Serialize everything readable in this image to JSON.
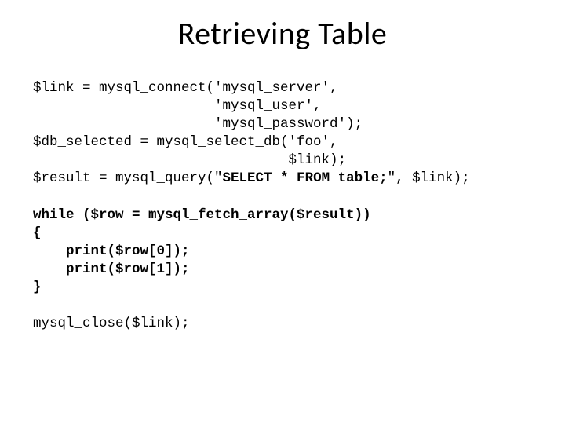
{
  "title": "Retrieving Table",
  "code": {
    "l1": "$link = mysql_connect('mysql_server',",
    "l2": "                      'mysql_user',",
    "l3": "                      'mysql_password');",
    "l4": "$db_selected = mysql_select_db('foo',",
    "l5": "                               $link);",
    "l6a": "$result = mysql_query(\"",
    "l6b": "SELECT * FROM table;",
    "l6c": "\", $link);",
    "b1": "while ($row = mysql_fetch_array($result))",
    "b2": "{",
    "b3": "    print($row[0]);",
    "b4": "    print($row[1]);",
    "b5": "}",
    "l13": "mysql_close($link);"
  }
}
